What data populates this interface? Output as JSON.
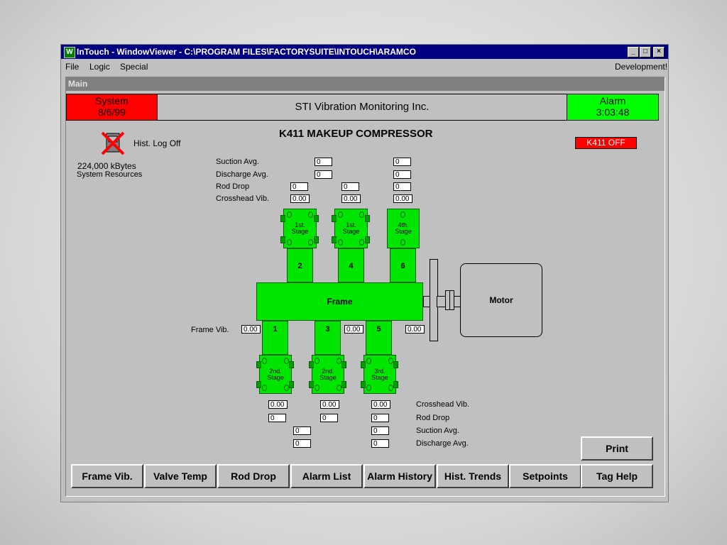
{
  "window": {
    "title": "InTouch - WindowViewer - C:\\PROGRAM FILES\\FACTORYSUITE\\INTOUCH\\ARAMCO",
    "min_glyph": "_",
    "max_glyph": "□",
    "close_glyph": "×"
  },
  "menu": {
    "file": "File",
    "logic": "Logic",
    "special": "Special",
    "development": "Development!"
  },
  "main_window_label": "Main",
  "header": {
    "system_label": "System",
    "system_date": "8/6/99",
    "company": "STI Vibration Monitoring Inc.",
    "alarm_label": "Alarm",
    "alarm_time": "3:03:48",
    "colors": {
      "system_bg": "#ff0000",
      "alarm_bg": "#00ff00"
    }
  },
  "status": {
    "hist_log": "Hist. Log Off",
    "memory": "224,000  kBytes",
    "memory_label": "System Resources",
    "title": "K411 MAKEUP COMPRESSOR",
    "compressor_state": "K411 OFF"
  },
  "top_labels": [
    "Suction Avg.",
    "Discharge Avg.",
    "Rod Drop",
    "Crosshead Vib."
  ],
  "top_values": {
    "col1": {
      "rod_drop": "0",
      "crosshead": "0.00"
    },
    "col2": {
      "suction": "0",
      "discharge": "0",
      "rod_drop": "0",
      "crosshead": "0.00"
    },
    "col3": {
      "suction": "0",
      "discharge": "0",
      "rod_drop": "0",
      "crosshead": "0.00"
    }
  },
  "diagram": {
    "top_cylinders": [
      {
        "stage": "1st.",
        "word": "Stage",
        "throw": "2"
      },
      {
        "stage": "1st.",
        "word": "Stage",
        "throw": "4"
      },
      {
        "stage": "4th.",
        "word": "Stage",
        "throw": "6"
      }
    ],
    "bottom_cylinders": [
      {
        "stage": "2nd.",
        "word": "Stage",
        "throw": "1"
      },
      {
        "stage": "2nd.",
        "word": "Stage",
        "throw": "3"
      },
      {
        "stage": "3rd.",
        "word": "Stage",
        "throw": "5"
      }
    ],
    "frame": "Frame",
    "motor": "Motor",
    "frame_vib_label": "Frame Vib.",
    "frame_vib_values": [
      "0.00",
      "0.00",
      "0.00"
    ]
  },
  "bottom_labels": [
    "Crosshead Vib.",
    "Rod Drop",
    "Suction Avg.",
    "Discharge Avg."
  ],
  "bottom_values": {
    "col1": {
      "crosshead": "0.00",
      "rod_drop": "0"
    },
    "col2": {
      "crosshead": "0.00",
      "rod_drop": "0",
      "suction": "0",
      "discharge": "0"
    },
    "col3": {
      "crosshead": "0.00",
      "rod_drop": "0",
      "suction": "0",
      "discharge": "0"
    }
  },
  "buttons": {
    "print": "Print",
    "nav": [
      "Frame Vib.",
      "Valve Temp",
      "Rod Drop",
      "Alarm List",
      "Alarm History",
      "Hist. Trends",
      "Setpoints",
      "Tag Help"
    ]
  }
}
